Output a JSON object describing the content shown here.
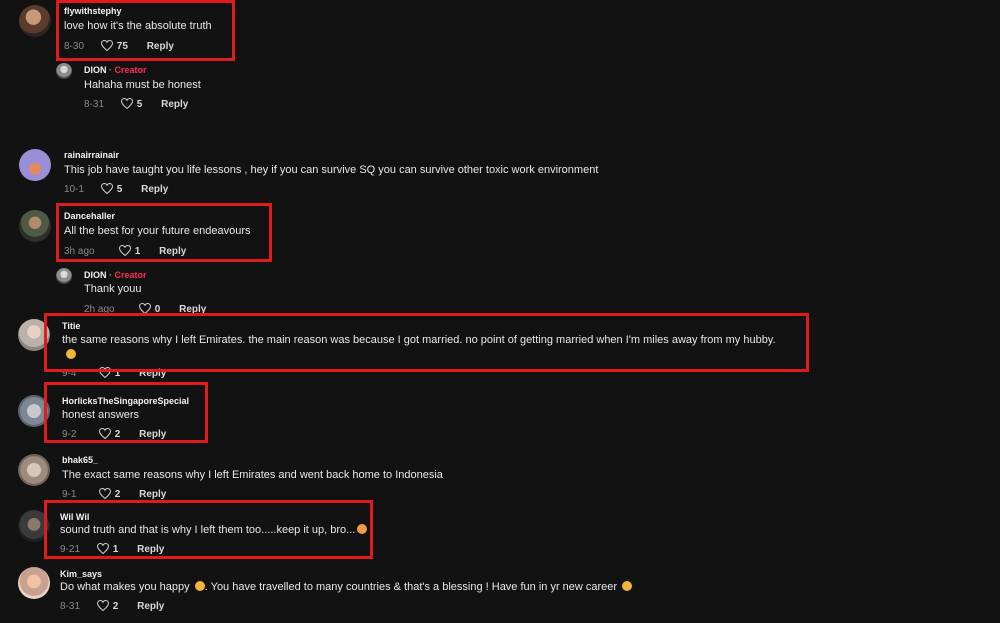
{
  "comments": [
    {
      "username": "flywithstephy",
      "text": "love how it's the absolute truth",
      "date": "8-30",
      "likes": "75",
      "reply": "Reply"
    },
    {
      "username": "DION",
      "badge": "Creator",
      "text": "Hahaha must be honest",
      "date": "8-31",
      "likes": "5",
      "reply": "Reply"
    },
    {
      "username": "rainairrainair",
      "text": "This job have taught you life lessons , hey if you can survive SQ you can survive other toxic work environment",
      "date": "10-1",
      "likes": "5",
      "reply": "Reply"
    },
    {
      "username": "Dancehaller",
      "text": "All the best for your future endeavours",
      "date": "3h ago",
      "likes": "1",
      "reply": "Reply"
    },
    {
      "username": "DION",
      "badge": "Creator",
      "text": "Thank youu",
      "date": "2h ago",
      "likes": "0",
      "reply": "Reply"
    },
    {
      "username": "Titie",
      "text": "the same reasons why I left Emirates. the main reason was because I got married. no point of getting married when I'm miles away from my hubby.",
      "date": "9-4",
      "likes": "1",
      "reply": "Reply"
    },
    {
      "username": "HorlicksTheSingaporeSpecial",
      "text": "honest answers",
      "date": "9-2",
      "likes": "2",
      "reply": "Reply"
    },
    {
      "username": "bhak65_",
      "text": "The exact same reasons why I left Emirates and went back home to Indonesia",
      "date": "9-1",
      "likes": "2",
      "reply": "Reply"
    },
    {
      "username": "Wil Wil",
      "text": "sound truth and that is why I left them too.....keep it up, bro...",
      "date": "9-21",
      "likes": "1",
      "reply": "Reply"
    },
    {
      "username": "Kim_says",
      "text": "Do what makes you happy",
      "text_mid": ". You have travelled to many countries & that's a blessing ! Have fun in yr new career",
      "date": "8-31",
      "likes": "2",
      "reply": "Reply"
    }
  ]
}
